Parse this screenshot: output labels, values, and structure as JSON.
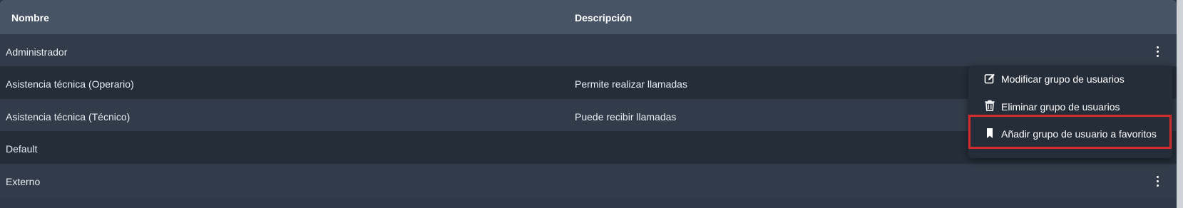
{
  "table": {
    "headers": {
      "name": "Nombre",
      "description": "Descripción"
    },
    "rows": [
      {
        "name": "Administrador",
        "description": ""
      },
      {
        "name": "Asistencia técnica (Operario)",
        "description": "Permite realizar llamadas"
      },
      {
        "name": "Asistencia técnica (Técnico)",
        "description": "Puede recibir llamadas"
      },
      {
        "name": "Default",
        "description": ""
      },
      {
        "name": "Externo",
        "description": ""
      }
    ]
  },
  "context_menu": {
    "items": [
      {
        "label": "Modificar grupo de usuarios",
        "icon": "edit-icon"
      },
      {
        "label": "Eliminar grupo de usuarios",
        "icon": "trash-icon"
      },
      {
        "label": "Añadir grupo de usuario a favoritos",
        "icon": "bookmark-icon"
      }
    ],
    "highlighted_item": "Eliminar grupo de usuarios",
    "highlight_color": "#d42c2c"
  },
  "colors": {
    "header_bg": "#475465",
    "row_light": "#313b49",
    "row_dark": "#252d39",
    "menu_bg": "#252d39"
  }
}
